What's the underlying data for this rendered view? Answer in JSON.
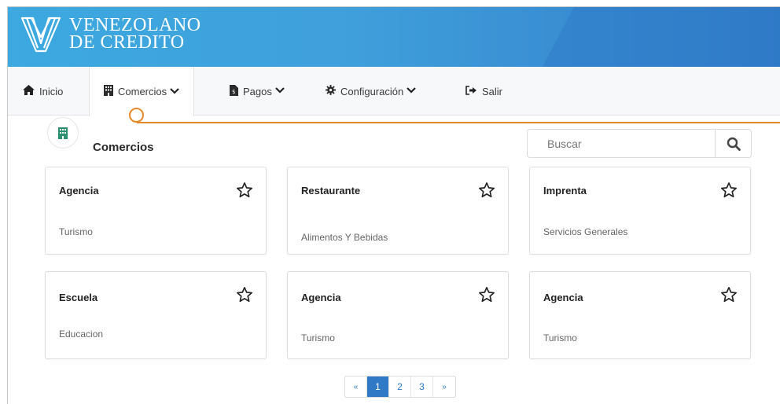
{
  "brand": {
    "line1": "VENEZOLANO",
    "line2": "DE CREDITO"
  },
  "nav": {
    "inicio": "Inicio",
    "comercios": "Comercios",
    "pagos": "Pagos",
    "configuracion": "Configuración",
    "salir": "Salir"
  },
  "section": {
    "title": "Comercios"
  },
  "search": {
    "placeholder": "Buscar"
  },
  "cards": [
    {
      "name": "Agencia",
      "category": "Turismo"
    },
    {
      "name": "Restaurante",
      "category": "Alimentos Y Bebidas"
    },
    {
      "name": "Imprenta",
      "category": "Servicios Generales"
    },
    {
      "name": "Escuela",
      "category": "Educacion"
    },
    {
      "name": "Agencia",
      "category": "Turismo"
    },
    {
      "name": "Agencia",
      "category": "Turismo"
    }
  ],
  "pagination": {
    "prev": "«",
    "pages": [
      "1",
      "2",
      "3"
    ],
    "next": "»",
    "current": "1"
  },
  "colors": {
    "brand_blue": "#3da9e0",
    "accent_orange": "#e7892a",
    "link_blue": "#3079c6"
  }
}
